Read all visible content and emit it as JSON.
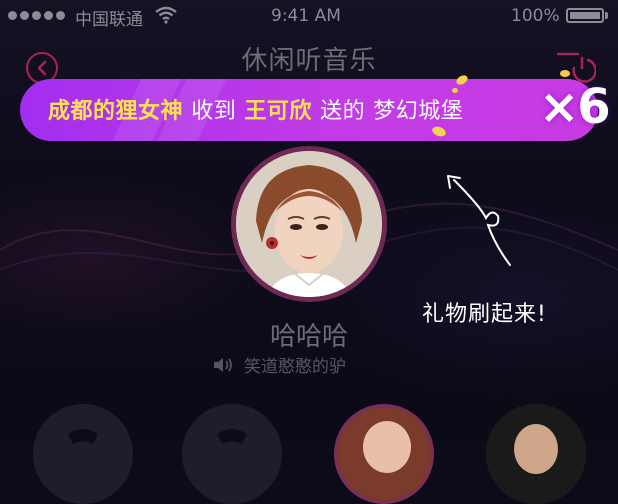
{
  "status": {
    "carrier": "中国联通",
    "time": "9:41 AM",
    "battery": "100%"
  },
  "header": {
    "title": "休闲听音乐"
  },
  "banner": {
    "sender": "成都的狸女神",
    "received": "收到",
    "receiver": "王可欣",
    "sent": "送的",
    "gift": "梦幻城堡",
    "multiplier": "×6"
  },
  "hint": {
    "text": "礼物刷起来!"
  },
  "host": {
    "name": "哈哈哈",
    "song": "笑道憨憨的驴"
  },
  "colors": {
    "accent": "#c23ce6",
    "highlight": "#ffe34d",
    "ring": "#a52457"
  },
  "icons": [
    "back-icon",
    "power-icon",
    "speaker-icon",
    "wifi-icon",
    "battery-icon"
  ]
}
